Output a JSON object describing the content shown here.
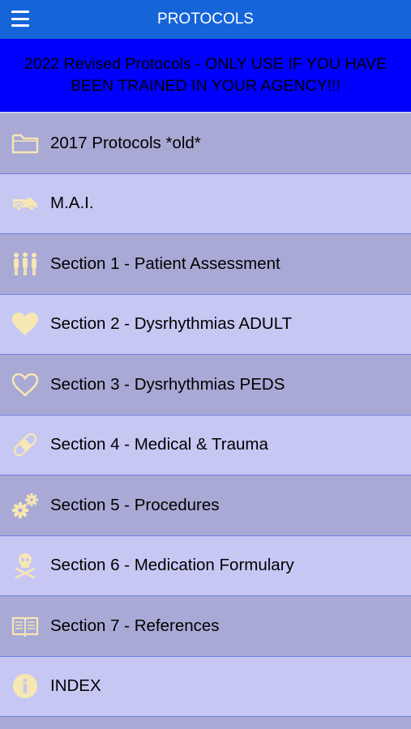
{
  "header": {
    "title": "PROTOCOLS",
    "menu_icon": "hamburger-menu-icon"
  },
  "banner": {
    "text": "2022 Revised Protocols - ONLY USE IF YOU HAVE BEEN TRAINED IN YOUR AGENCY!!!"
  },
  "colors": {
    "header_bg": "#1565d8",
    "banner_bg": "#0000ff",
    "row_dark": "#a9a9d6",
    "row_light": "#c7c7f3",
    "icon": "#f7e7b2"
  },
  "items": [
    {
      "label": "2017 Protocols *old*",
      "icon": "folder-icon"
    },
    {
      "label": "M.A.I.",
      "icon": "ambulance-icon"
    },
    {
      "label": "Section 1 - Patient Assessment",
      "icon": "people-icon"
    },
    {
      "label": "Section 2 - Dysrhythmias ADULT",
      "icon": "heart-filled-icon"
    },
    {
      "label": "Section 3 - Dysrhythmias PEDS",
      "icon": "heart-outline-icon"
    },
    {
      "label": "Section 4 - Medical & Trauma",
      "icon": "bandage-icon"
    },
    {
      "label": "Section 5 - Procedures",
      "icon": "gears-icon"
    },
    {
      "label": "Section 6 - Medication Formulary",
      "icon": "skull-crossbones-icon"
    },
    {
      "label": "Section 7 - References",
      "icon": "book-icon"
    },
    {
      "label": "INDEX",
      "icon": "info-icon"
    }
  ]
}
